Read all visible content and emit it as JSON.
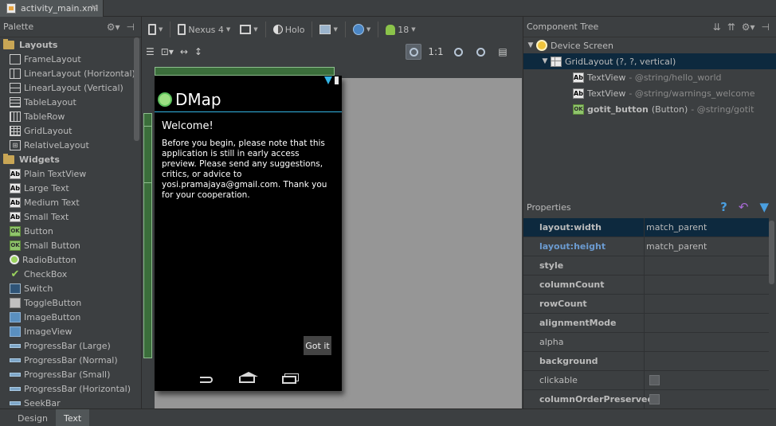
{
  "editor_tab": {
    "filename": "activity_main.xml",
    "close": "✕"
  },
  "palette": {
    "title": "Palette",
    "categories": [
      {
        "label": "Layouts",
        "items": [
          {
            "label": "FrameLayout",
            "icon": "frame-layout-icon"
          },
          {
            "label": "LinearLayout (Horizontal)",
            "icon": "linear-horizontal-icon"
          },
          {
            "label": "LinearLayout (Vertical)",
            "icon": "linear-vertical-icon"
          },
          {
            "label": "TableLayout",
            "icon": "table-layout-icon"
          },
          {
            "label": "TableRow",
            "icon": "table-row-icon"
          },
          {
            "label": "GridLayout",
            "icon": "grid-layout-icon"
          },
          {
            "label": "RelativeLayout",
            "icon": "relative-layout-icon"
          }
        ]
      },
      {
        "label": "Widgets",
        "items": [
          {
            "label": "Plain TextView",
            "icon": "textview-icon"
          },
          {
            "label": "Large Text",
            "icon": "textview-icon"
          },
          {
            "label": "Medium Text",
            "icon": "textview-icon"
          },
          {
            "label": "Small Text",
            "icon": "textview-icon"
          },
          {
            "label": "Button",
            "icon": "button-icon"
          },
          {
            "label": "Small Button",
            "icon": "button-icon"
          },
          {
            "label": "RadioButton",
            "icon": "radio-button-icon"
          },
          {
            "label": "CheckBox",
            "icon": "checkbox-icon"
          },
          {
            "label": "Switch",
            "icon": "switch-icon"
          },
          {
            "label": "ToggleButton",
            "icon": "toggle-button-icon"
          },
          {
            "label": "ImageButton",
            "icon": "image-button-icon"
          },
          {
            "label": "ImageView",
            "icon": "image-view-icon"
          },
          {
            "label": "ProgressBar (Large)",
            "icon": "progressbar-icon"
          },
          {
            "label": "ProgressBar (Normal)",
            "icon": "progressbar-icon"
          },
          {
            "label": "ProgressBar (Small)",
            "icon": "progressbar-icon"
          },
          {
            "label": "ProgressBar (Horizontal)",
            "icon": "progressbar-icon"
          },
          {
            "label": "SeekBar",
            "icon": "seekbar-icon"
          }
        ]
      }
    ]
  },
  "toolbar": {
    "device": "Nexus 4",
    "theme": "Holo",
    "api_level": "18"
  },
  "preview": {
    "app_title": "DMap",
    "welcome": "Welcome!",
    "warning": "Before you begin, please note that this application is still in early access preview. Please send any suggestions, critics, or advice to yosi.pramajaya@gmail.com. Thank you for your cooperation.",
    "button": "Got it"
  },
  "component_tree": {
    "title": "Component Tree",
    "root": "Device Screen",
    "grid": "GridLayout (?, ?, vertical)",
    "children": [
      {
        "name": "TextView",
        "detail": "- @string/hello_world",
        "icon": "textview-icon"
      },
      {
        "name": "TextView",
        "detail": "- @string/warnings_welcome",
        "icon": "textview-icon"
      },
      {
        "name": "gotit_button",
        "type": "(Button)",
        "detail": "- @string/gotit",
        "icon": "button-icon"
      }
    ]
  },
  "properties": {
    "title": "Properties",
    "rows": [
      {
        "name": "layout:width",
        "value": "match_parent"
      },
      {
        "name": "layout:height",
        "value": "match_parent"
      },
      {
        "name": "style",
        "value": ""
      },
      {
        "name": "columnCount",
        "value": ""
      },
      {
        "name": "rowCount",
        "value": ""
      },
      {
        "name": "alignmentMode",
        "value": ""
      },
      {
        "name": "alpha",
        "value": ""
      },
      {
        "name": "background",
        "value": ""
      },
      {
        "name": "clickable",
        "value": ""
      },
      {
        "name": "columnOrderPreserved",
        "value": ""
      }
    ]
  },
  "bottom_tabs": {
    "design": "Design",
    "text": "Text"
  },
  "colors": {
    "accent": "#33b5e5",
    "selection": "#0d293e",
    "ruler": "#3b6e3b"
  }
}
